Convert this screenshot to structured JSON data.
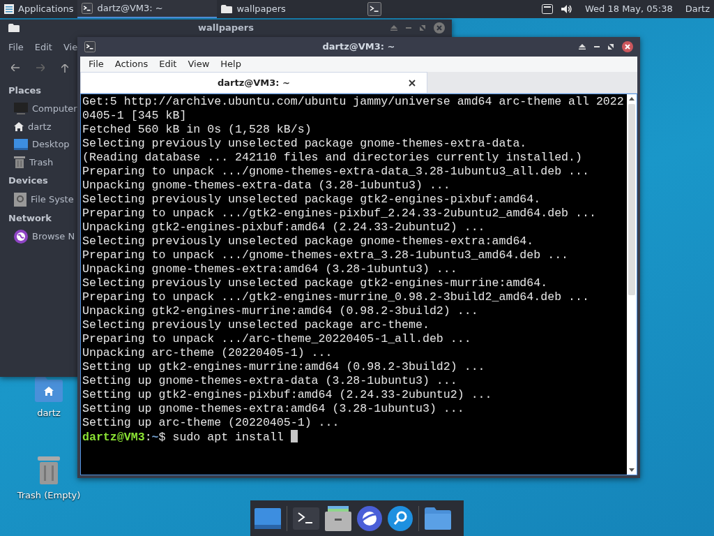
{
  "top_panel": {
    "apps_menu": "Applications",
    "tasks": [
      {
        "title": "dartz@VM3: ~",
        "kind": "terminal",
        "selected": true
      },
      {
        "title": "wallpapers",
        "kind": "folder",
        "selected": false
      }
    ],
    "clock": "Wed 18 May, 05:38",
    "user": "Dartz"
  },
  "file_manager": {
    "title": "wallpapers",
    "menu": [
      "File",
      "Edit",
      "Vie"
    ],
    "sections": [
      {
        "heading": "Places",
        "items": [
          {
            "label": "Computer",
            "kind": "computer"
          },
          {
            "label": "dartz",
            "kind": "home"
          },
          {
            "label": "Desktop",
            "kind": "desktop"
          },
          {
            "label": "Trash",
            "kind": "trash"
          }
        ]
      },
      {
        "heading": "Devices",
        "items": [
          {
            "label": "File Syste",
            "kind": "drive"
          }
        ]
      },
      {
        "heading": "Network",
        "items": [
          {
            "label": "Browse N",
            "kind": "network"
          }
        ]
      }
    ]
  },
  "terminal": {
    "title": "dartz@VM3: ~",
    "menu": [
      "File",
      "Actions",
      "Edit",
      "View",
      "Help"
    ],
    "tab": {
      "label": "dartz@VM3: ~",
      "selected": true
    },
    "lines": [
      "Get:5 http://archive.ubuntu.com/ubuntu jammy/universe amd64 arc-theme all 2022",
      "0405-1 [345 kB]",
      "Fetched 560 kB in 0s (1,528 kB/s)",
      "Selecting previously unselected package gnome-themes-extra-data.",
      "(Reading database ... 242110 files and directories currently installed.)",
      "Preparing to unpack .../gnome-themes-extra-data_3.28-1ubuntu3_all.deb ...",
      "Unpacking gnome-themes-extra-data (3.28-1ubuntu3) ...",
      "Selecting previously unselected package gtk2-engines-pixbuf:amd64.",
      "Preparing to unpack .../gtk2-engines-pixbuf_2.24.33-2ubuntu2_amd64.deb ...",
      "Unpacking gtk2-engines-pixbuf:amd64 (2.24.33-2ubuntu2) ...",
      "Selecting previously unselected package gnome-themes-extra:amd64.",
      "Preparing to unpack .../gnome-themes-extra_3.28-1ubuntu3_amd64.deb ...",
      "Unpacking gnome-themes-extra:amd64 (3.28-1ubuntu3) ...",
      "Selecting previously unselected package gtk2-engines-murrine:amd64.",
      "Preparing to unpack .../gtk2-engines-murrine_0.98.2-3build2_amd64.deb ...",
      "Unpacking gtk2-engines-murrine:amd64 (0.98.2-3build2) ...",
      "Selecting previously unselected package arc-theme.",
      "Preparing to unpack .../arc-theme_20220405-1_all.deb ...",
      "Unpacking arc-theme (20220405-1) ...",
      "Setting up gtk2-engines-murrine:amd64 (0.98.2-3build2) ...",
      "Setting up gnome-themes-extra-data (3.28-1ubuntu3) ...",
      "Setting up gtk2-engines-pixbuf:amd64 (2.24.33-2ubuntu2) ...",
      "Setting up gnome-themes-extra:amd64 (3.28-1ubuntu3) ...",
      "Setting up arc-theme (20220405-1) ..."
    ],
    "prompt": {
      "user_host": "dartz@VM3",
      "separator": ":",
      "path": "~",
      "symbol": "$",
      "command": "sudo apt install"
    }
  },
  "desktop_icons": [
    {
      "label": "dartz",
      "kind": "home"
    },
    {
      "label": "Trash (Empty)",
      "kind": "trash"
    }
  ],
  "dock": [
    {
      "kind": "desktop"
    },
    {
      "kind": "terminal"
    },
    {
      "kind": "files"
    },
    {
      "kind": "browser"
    },
    {
      "kind": "search"
    },
    {
      "kind": "folder"
    }
  ]
}
